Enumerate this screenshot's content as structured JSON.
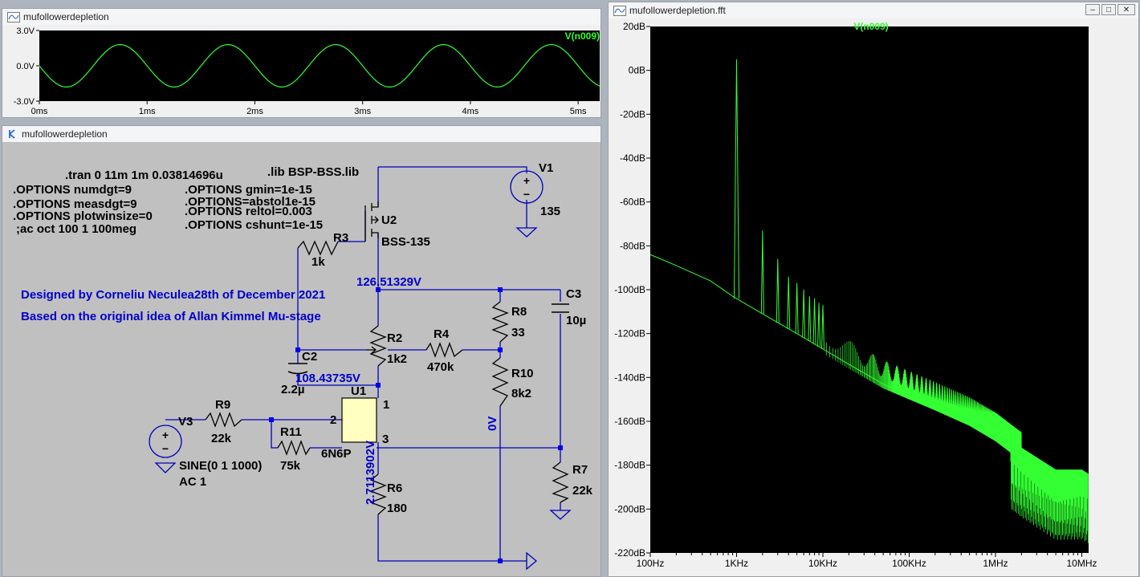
{
  "colors": {
    "trace": "#33ff33",
    "schematic_blue": "#0000cc",
    "plot_bg": "#000000",
    "schematic_bg": "#c0c0c0",
    "wire": "#0000bb",
    "label": "#000000",
    "tube_fill": "#ffffc0"
  },
  "icons": {
    "waveform": "waveform-icon",
    "schematic": "schematic-icon",
    "fft": "fft-icon",
    "minimize": "minimize-icon",
    "maximize": "maximize-icon",
    "close": "close-icon"
  },
  "transient_window": {
    "title": "mufollowerdepletion",
    "chart_data": {
      "type": "line",
      "series": [
        {
          "name": "V(n009)",
          "function": "1.8*sin(2*pi*1000*t)",
          "amplitude_v": 1.8,
          "frequency_hz": 1000
        }
      ],
      "x_unit": "ms",
      "xlim": [
        0,
        5.2
      ],
      "ylim": [
        -3,
        3
      ],
      "x_ticks": [
        "0ms",
        "1ms",
        "2ms",
        "3ms",
        "4ms",
        "5ms"
      ],
      "x_tick_values": [
        0,
        1,
        2,
        3,
        4,
        5
      ],
      "y_ticks": [
        "3.0V",
        "0.0V",
        "-3.0V"
      ],
      "y_tick_values": [
        3,
        0,
        -3
      ],
      "grid": false
    }
  },
  "schematic_window": {
    "title": "mufollowerdepletion",
    "directives": [
      ".tran 0 11m 1m 0.03814696u",
      ".OPTIONS numdgt=9",
      ".OPTIONS measdgt=9",
      ".OPTIONS plotwinsize=0",
      ";ac oct 100 1 100meg",
      ".lib BSP-BSS.lib",
      ".OPTIONS gmin=1e-15",
      ".OPTIONS=abstol1e-15",
      ".OPTIONS reltol=0.003",
      ".OPTIONS cshunt=1e-15"
    ],
    "notes": [
      "Designed by Corneliu Neculea28th of December 2021",
      "Based on the original idea of Allan Kimmel Mu-stage"
    ],
    "node_voltages": [
      "126.51329V",
      "108.43735V",
      "2.7113902V",
      "0V"
    ],
    "components": {
      "v1": {
        "name": "V1",
        "value": "135"
      },
      "u2": {
        "name": "U2",
        "value": "BSS-135"
      },
      "r3": {
        "name": "R3",
        "value": "1k"
      },
      "c3": {
        "name": "C3",
        "value": "10µ"
      },
      "r8": {
        "name": "R8",
        "value": "33"
      },
      "r2": {
        "name": "R2",
        "value": "1k2"
      },
      "r4": {
        "name": "R4",
        "value": "470k"
      },
      "c2": {
        "name": "C2",
        "value": "2.2µ"
      },
      "r10": {
        "name": "R10",
        "value": "8k2"
      },
      "u1": {
        "name": "U1",
        "value": "6N6P",
        "pins": [
          "1",
          "2",
          "3"
        ]
      },
      "r9": {
        "name": "R9",
        "value": "22k"
      },
      "v3": {
        "name": "V3",
        "value": "SINE(0 1 1000)",
        "value2": "AC 1"
      },
      "r11": {
        "name": "R11",
        "value": "75k"
      },
      "r7": {
        "name": "R7",
        "value": "22k"
      },
      "r6": {
        "name": "R6",
        "value": "180"
      }
    }
  },
  "fft_window": {
    "title": "mufollowerdepletion.fft",
    "chart_data": {
      "type": "line",
      "series": [
        {
          "name": "V(n009)",
          "noise_floor_db": [
            [
              100,
              -84
            ],
            [
              200,
              -89
            ],
            [
              500,
              -96
            ],
            [
              900,
              -103
            ],
            [
              2000,
              -111
            ],
            [
              5000,
              -120
            ],
            [
              10000,
              -127
            ],
            [
              20000,
              -134
            ],
            [
              50000,
              -143
            ],
            [
              100000,
              -148
            ],
            [
              200000,
              -153
            ],
            [
              500000,
              -160
            ],
            [
              1000000,
              -167
            ],
            [
              2000000,
              -176
            ],
            [
              5000000,
              -186
            ],
            [
              10000000,
              -186
            ],
            [
              12000000,
              -188
            ]
          ],
          "peaks_db": [
            [
              1000,
              5
            ],
            [
              2000,
              -73
            ],
            [
              3000,
              -86
            ],
            [
              4000,
              -94
            ],
            [
              5000,
              -97
            ],
            [
              6000,
              -100
            ],
            [
              7000,
              -103
            ],
            [
              8000,
              -104
            ],
            [
              9000,
              -106
            ],
            [
              10000,
              -107
            ]
          ]
        }
      ],
      "x_scale": "log",
      "xlim": [
        100,
        12000000
      ],
      "ylim": [
        -220,
        20
      ],
      "x_ticks": [
        "100Hz",
        "1KHz",
        "10KHz",
        "100KHz",
        "1MHz",
        "10MHz"
      ],
      "x_tick_values": [
        100,
        1000,
        10000,
        100000,
        1000000,
        10000000
      ],
      "y_ticks": [
        "20dB",
        "0dB",
        "-20dB",
        "-40dB",
        "-60dB",
        "-80dB",
        "-100dB",
        "-120dB",
        "-140dB",
        "-160dB",
        "-180dB",
        "-200dB",
        "-220dB"
      ],
      "y_tick_values": [
        20,
        0,
        -20,
        -40,
        -60,
        -80,
        -100,
        -120,
        -140,
        -160,
        -180,
        -200,
        -220
      ],
      "grid": false
    }
  }
}
